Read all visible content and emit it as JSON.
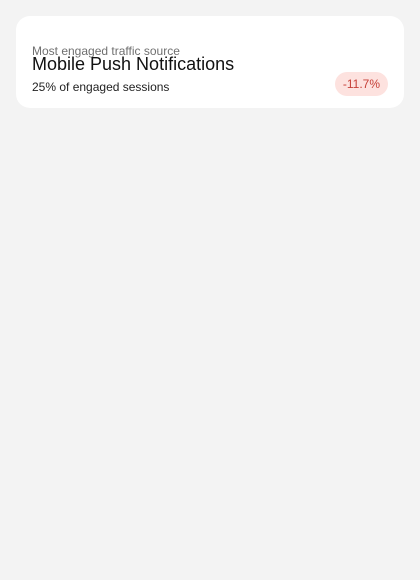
{
  "card": {
    "subtitle": "Most engaged traffic source",
    "title": "Mobile Push Notifications",
    "caption": "25% of engaged sessions",
    "change_badge": "-11.7%",
    "colors": {
      "badge_background": "#fde2df",
      "badge_text": "#c64038"
    }
  }
}
